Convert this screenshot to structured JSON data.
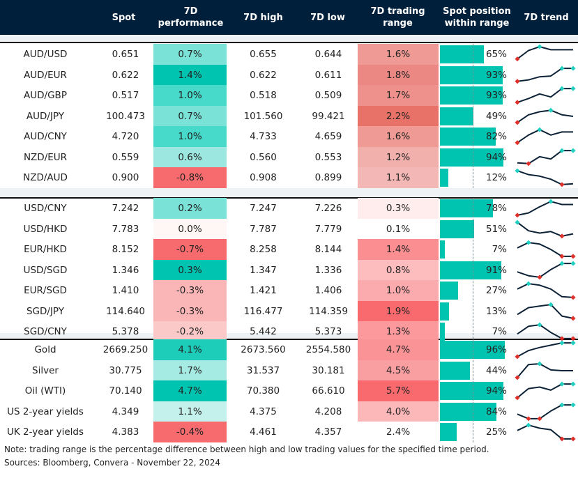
{
  "headers": {
    "spot": "Spot",
    "perf": "7D performance",
    "high": "7D high",
    "low": "7D low",
    "range": "7D trading range",
    "position": "Spot position within range",
    "trend": "7D trend"
  },
  "colors": {
    "header_bg": "#001f3a",
    "bar": "#00c4b0",
    "trend_line": "#0d2236",
    "marker_high": "#1fcfc0",
    "marker_low": "#e0302a"
  },
  "groups": [
    {
      "rows": [
        {
          "name": "AUD/USD",
          "spot": "0.651",
          "perf": "0.7%",
          "perf_color": "#7ae2d6",
          "high": "0.655",
          "low": "0.644",
          "range": "1.6%",
          "range_color": "#ef9a94",
          "position_pct": 65,
          "position": "65%",
          "trend": [
            0.2,
            0.75,
            1.0,
            0.8,
            0.8,
            0.8
          ]
        },
        {
          "name": "AUD/EUR",
          "spot": "0.622",
          "perf": "1.4%",
          "perf_color": "#00c4b0",
          "high": "0.622",
          "low": "0.611",
          "range": "1.8%",
          "range_color": "#ec8884",
          "position_pct": 93,
          "position": "93%",
          "trend": [
            0.1,
            0.2,
            0.4,
            0.45,
            0.95,
            0.95
          ]
        },
        {
          "name": "AUD/GBP",
          "spot": "0.517",
          "perf": "1.0%",
          "perf_color": "#47d9c9",
          "high": "0.518",
          "low": "0.509",
          "range": "1.7%",
          "range_color": "#ee918c",
          "position_pct": 93,
          "position": "93%",
          "trend": [
            0.05,
            0.3,
            0.6,
            0.4,
            0.95,
            0.95
          ]
        },
        {
          "name": "AUD/JPY",
          "spot": "100.473",
          "perf": "0.7%",
          "perf_color": "#7ae2d6",
          "high": "101.560",
          "low": "99.421",
          "range": "2.2%",
          "range_color": "#e87268",
          "position_pct": 49,
          "position": "49%",
          "trend": [
            0.1,
            0.6,
            0.8,
            0.9,
            0.6,
            0.5
          ]
        },
        {
          "name": "AUD/CNY",
          "spot": "4.720",
          "perf": "1.0%",
          "perf_color": "#47d9c9",
          "high": "4.733",
          "low": "4.659",
          "range": "1.6%",
          "range_color": "#ef9a94",
          "position_pct": 82,
          "position": "82%",
          "trend": [
            0.1,
            0.6,
            0.95,
            0.6,
            0.8,
            0.8
          ]
        },
        {
          "name": "NZD/EUR",
          "spot": "0.559",
          "perf": "0.6%",
          "perf_color": "#9ce8e0",
          "high": "0.560",
          "low": "0.553",
          "range": "1.2%",
          "range_color": "#f2b0ad",
          "position_pct": 94,
          "position": "94%",
          "trend": [
            0.15,
            0.1,
            0.55,
            0.4,
            0.95,
            0.95
          ]
        },
        {
          "name": "NZD/AUD",
          "spot": "0.900",
          "perf": "-0.8%",
          "perf_color": "#f76b6e",
          "high": "0.908",
          "low": "0.899",
          "range": "1.1%",
          "range_color": "#f3b8b6",
          "position_pct": 12,
          "position": "12%",
          "trend": [
            0.95,
            0.7,
            0.6,
            0.4,
            0.05,
            0.1
          ]
        }
      ]
    },
    {
      "rows": [
        {
          "name": "USD/CNY",
          "spot": "7.242",
          "perf": "0.2%",
          "perf_color": "#7ae2d6",
          "high": "7.247",
          "low": "7.226",
          "range": "0.3%",
          "range_color": "#ffeded",
          "position_pct": 78,
          "position": "78%",
          "trend": [
            0.05,
            0.2,
            0.6,
            0.95,
            0.75,
            0.75
          ]
        },
        {
          "name": "USD/HKD",
          "spot": "7.783",
          "perf": "0.0%",
          "perf_color": "#fff6f6",
          "high": "7.787",
          "low": "7.779",
          "range": "0.1%",
          "range_color": "#ffffff",
          "position_pct": 51,
          "position": "51%",
          "trend": [
            0.95,
            0.4,
            0.25,
            0.35,
            0.05,
            0.2
          ]
        },
        {
          "name": "EUR/HKD",
          "spot": "8.152",
          "perf": "-0.7%",
          "perf_color": "#f76b6e",
          "high": "8.258",
          "low": "8.144",
          "range": "1.4%",
          "range_color": "#fa8e91",
          "position_pct": 7,
          "position": "7%",
          "trend": [
            0.6,
            0.95,
            0.85,
            0.5,
            0.05,
            0.05
          ]
        },
        {
          "name": "USD/SGD",
          "spot": "1.346",
          "perf": "0.3%",
          "perf_color": "#00c4b0",
          "high": "1.347",
          "low": "1.336",
          "range": "0.8%",
          "range_color": "#fdbcbe",
          "position_pct": 91,
          "position": "91%",
          "trend": [
            0.4,
            0.15,
            0.05,
            0.55,
            0.95,
            0.95
          ]
        },
        {
          "name": "EUR/SGD",
          "spot": "1.410",
          "perf": "-0.3%",
          "perf_color": "#fab5b6",
          "high": "1.421",
          "low": "1.406",
          "range": "1.0%",
          "range_color": "#fbaaad",
          "position_pct": 27,
          "position": "27%",
          "trend": [
            0.6,
            0.95,
            0.85,
            0.6,
            0.1,
            0.05
          ]
        },
        {
          "name": "SGD/JPY",
          "spot": "114.640",
          "perf": "-0.3%",
          "perf_color": "#fab5b6",
          "high": "116.477",
          "low": "114.359",
          "range": "1.9%",
          "range_color": "#f86a6d",
          "position_pct": 13,
          "position": "13%",
          "trend": [
            0.3,
            0.75,
            0.85,
            0.95,
            0.2,
            0.05
          ]
        },
        {
          "name": "SGD/CNY",
          "spot": "5.378",
          "perf": "-0.2%",
          "perf_color": "#fcc9c9",
          "high": "5.442",
          "low": "5.373",
          "range": "1.3%",
          "range_color": "#fb999c",
          "position_pct": 7,
          "position": "7%",
          "trend": [
            0.35,
            0.85,
            0.95,
            0.45,
            0.05,
            0.05
          ]
        }
      ]
    },
    {
      "rows": [
        {
          "name": "Gold",
          "spot": "2669.250",
          "perf": "4.1%",
          "perf_color": "#1dcdba",
          "high": "2673.560",
          "low": "2554.580",
          "range": "4.7%",
          "range_color": "#fa9395",
          "position_pct": 96,
          "position": "96%",
          "trend": [
            0.05,
            0.45,
            0.65,
            0.8,
            0.95,
            0.95
          ]
        },
        {
          "name": "Silver",
          "spot": "30.775",
          "perf": "1.7%",
          "perf_color": "#a6ebe3",
          "high": "31.537",
          "low": "30.181",
          "range": "4.5%",
          "range_color": "#fa9fa1",
          "position_pct": 44,
          "position": "44%",
          "trend": [
            0.05,
            0.9,
            0.95,
            0.55,
            0.5,
            0.5
          ]
        },
        {
          "name": "Oil (WTI)",
          "spot": "70.140",
          "perf": "4.7%",
          "perf_color": "#00c4b0",
          "high": "70.380",
          "low": "66.610",
          "range": "5.7%",
          "range_color": "#f86a6d",
          "position_pct": 94,
          "position": "94%",
          "trend": [
            0.05,
            0.65,
            0.75,
            0.55,
            0.95,
            0.95
          ]
        },
        {
          "name": "US 2-year yields",
          "spot": "4.349",
          "perf": "1.1%",
          "perf_color": "#c4f1eb",
          "high": "4.375",
          "low": "4.208",
          "range": "4.0%",
          "range_color": "#fcb7b9",
          "position_pct": 84,
          "position": "84%",
          "trend": [
            0.35,
            0.05,
            0.05,
            0.55,
            0.95,
            0.95
          ]
        },
        {
          "name": "UK 2-year yields",
          "spot": "4.383",
          "perf": "-0.4%",
          "perf_color": "#f76b6e",
          "high": "4.461",
          "low": "4.357",
          "range": "2.4%",
          "range_color": "#ffffff",
          "position_pct": 25,
          "position": "25%",
          "trend": [
            0.6,
            0.95,
            0.75,
            0.65,
            0.05,
            0.05
          ]
        }
      ]
    }
  ],
  "footer": {
    "note": "Note: trading range is the percentage difference between high and low trading values for the specified time period.",
    "sources": "Sources: Bloomberg, Convera - November 22, 2024"
  }
}
